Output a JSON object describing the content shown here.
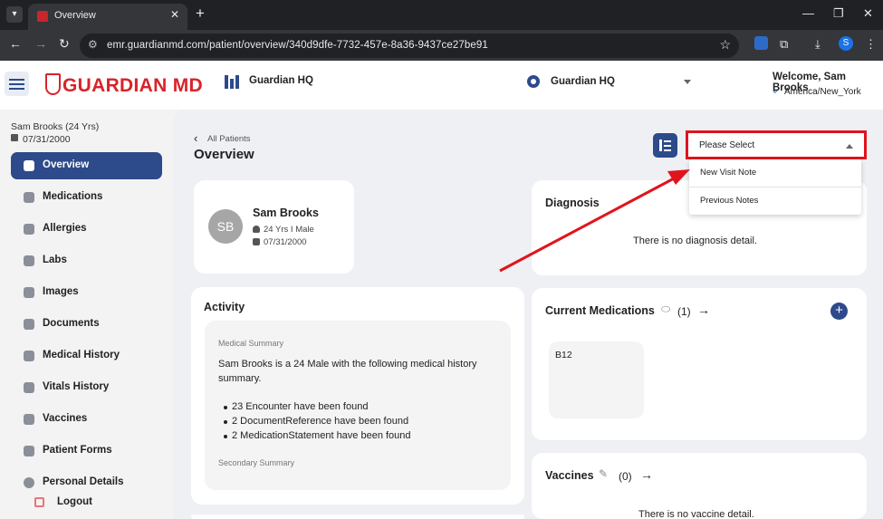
{
  "browser": {
    "tab_title": "Overview",
    "url": "emr.guardianmd.com/patient/overview/340d9dfe-7732-457e-8a36-9437ce27be91",
    "profile_initial": "S"
  },
  "header": {
    "logo_text": "GUARDIAN MD",
    "org_name": "Guardian HQ",
    "location_name": "Guardian HQ",
    "welcome": "Welcome, Sam Brooks",
    "timezone": "America/New_York"
  },
  "sidebar": {
    "patient_name": "Sam Brooks (24 Yrs)",
    "patient_dob": "07/31/2000",
    "items": [
      {
        "label": "Overview",
        "icon": "overview-icon",
        "active": true
      },
      {
        "label": "Medications",
        "icon": "pill-icon"
      },
      {
        "label": "Allergies",
        "icon": "hourglass-icon"
      },
      {
        "label": "Labs",
        "icon": "document-icon"
      },
      {
        "label": "Images",
        "icon": "image-icon"
      },
      {
        "label": "Documents",
        "icon": "folder-icon"
      },
      {
        "label": "Medical History",
        "icon": "history-icon"
      },
      {
        "label": "Vitals History",
        "icon": "vitals-icon"
      },
      {
        "label": "Vaccines",
        "icon": "syringe-icon"
      },
      {
        "label": "Patient Forms",
        "icon": "form-icon"
      },
      {
        "label": "Personal Details",
        "icon": "user-icon"
      }
    ],
    "logout_label": "Logout"
  },
  "main": {
    "breadcrumb": "All Patients",
    "title": "Overview",
    "select": {
      "placeholder": "Please Select",
      "options": [
        "New Visit Note",
        "Previous Notes"
      ]
    },
    "patient_card": {
      "initials": "SB",
      "name": "Sam Brooks",
      "age_gender": "24 Yrs I Male",
      "dob": "07/31/2000"
    },
    "diagnosis": {
      "title": "Diagnosis",
      "empty": "There is no diagnosis detail."
    },
    "activity": {
      "title": "Activity",
      "medical_summary_label": "Medical Summary",
      "summary_text": "Sam Brooks is a 24 Male with the following medical history summary.",
      "bullets": [
        "23 Encounter have been found",
        "2 DocumentReference have been found",
        "2 MedicationStatement have been found"
      ],
      "secondary_label": "Secondary Summary"
    },
    "current_medications": {
      "title": "Current Medications",
      "count": "(1)",
      "items": [
        "B12"
      ]
    },
    "vaccines": {
      "title": "Vaccines",
      "count": "(0)",
      "empty": "There is no vaccine detail."
    }
  },
  "colors": {
    "brand_red": "#d8232a",
    "primary_navy": "#2d4a8a",
    "annotation_red": "#e0141c"
  }
}
